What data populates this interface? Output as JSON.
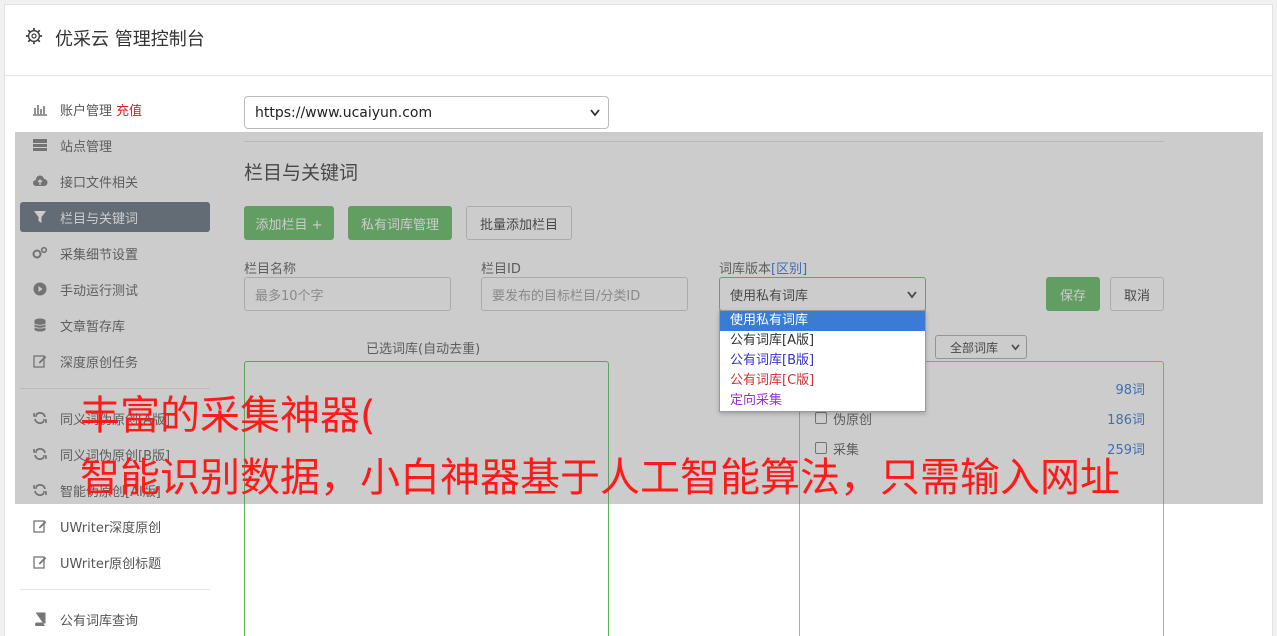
{
  "header": {
    "title": "优采云 管理控制台",
    "icon": "gear-icon"
  },
  "sidebar": {
    "items": [
      {
        "label": "账户管理",
        "badge": "充值",
        "icon": "bar-chart-icon"
      },
      {
        "label": "站点管理",
        "icon": "server-icon"
      },
      {
        "label": "接口文件相关",
        "icon": "cloud-upload-icon"
      },
      {
        "label": "栏目与关键词",
        "icon": "filter-icon",
        "active": true
      },
      {
        "label": "采集细节设置",
        "icon": "cogs-icon"
      },
      {
        "label": "手动运行测试",
        "icon": "play-circle-icon"
      },
      {
        "label": "文章暂存库",
        "icon": "database-icon"
      },
      {
        "label": "深度原创任务",
        "icon": "edit-icon"
      }
    ],
    "items2": [
      {
        "label": "同义词伪原创[A版]",
        "icon": "refresh-icon"
      },
      {
        "label": "同义词伪原创[B版]",
        "icon": "refresh-icon"
      },
      {
        "label": "智能伪原创[AI版]",
        "icon": "refresh-icon"
      },
      {
        "label": "UWriter深度原创",
        "icon": "edit-icon"
      },
      {
        "label": "UWriter原创标题",
        "icon": "edit-icon"
      }
    ],
    "items3": [
      {
        "label": "公有词库查询",
        "icon": "book-icon"
      }
    ]
  },
  "site_select": {
    "value": "https://www.ucaiyun.com"
  },
  "section": {
    "title": "栏目与关键词"
  },
  "buttons": {
    "add_column": "添加栏目 +",
    "private_lib": "私有词库管理",
    "batch_add": "批量添加栏目",
    "save": "保存",
    "cancel": "取消"
  },
  "form": {
    "name_label": "栏目名称",
    "name_placeholder": "最多10个字",
    "id_label": "栏目ID",
    "id_placeholder": "要发布的目标栏目/分类ID",
    "lib_label": "词库版本",
    "lib_label_link": "[区别]",
    "lib_value": "使用私有词库"
  },
  "dropdown": {
    "options": [
      {
        "label": "使用私有词库",
        "color": "#ffffff"
      },
      {
        "label": "公有词库[A版]",
        "color": "#333333"
      },
      {
        "label": "公有词库[B版]",
        "color": "#3333cc"
      },
      {
        "label": "公有词库[C版]",
        "color": "#cc3333"
      },
      {
        "label": "定向采集",
        "color": "#9933cc"
      }
    ]
  },
  "selected_box": {
    "label": "已选词库(自动去重)"
  },
  "filter": {
    "value": "全部词库"
  },
  "library_rows": [
    {
      "label": "",
      "count": "98词"
    },
    {
      "label": "伪原创",
      "count": "186词"
    },
    {
      "label": "采集",
      "count": "259词"
    }
  ],
  "banner": {
    "line1": "丰富的采集神器(",
    "line2": "智能识别数据，小白神器基于人工智能算法，只需输入网址"
  },
  "colors": {
    "accent_green": "#5cb85c",
    "active_nav": "#5f6b7a",
    "link_blue": "#2a6fd6",
    "banner_red": "#ff1a1a"
  }
}
